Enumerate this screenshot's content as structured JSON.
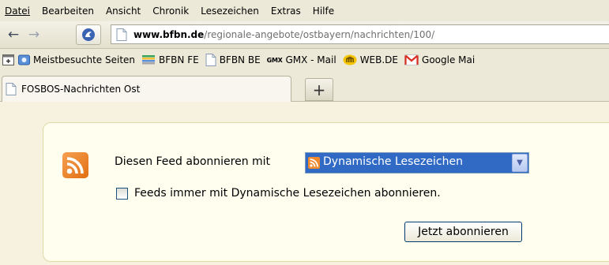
{
  "menubar": {
    "items": [
      {
        "label": "Datei"
      },
      {
        "label": "Bearbeiten"
      },
      {
        "label": "Ansicht"
      },
      {
        "label": "Chronik"
      },
      {
        "label": "Lesezeichen"
      },
      {
        "label": "Extras"
      },
      {
        "label": "Hilfe"
      }
    ]
  },
  "navbar": {
    "url_domain": "www.bfbn.de",
    "url_path": "/regionale-angebote/ostbayern/nachrichten/100/"
  },
  "bookmarks": {
    "items": [
      {
        "label": "Meistbesuchte Seiten"
      },
      {
        "label": "BFBN FE"
      },
      {
        "label": "BFBN BE"
      },
      {
        "label": "GMX - Mail",
        "mark": "GMX"
      },
      {
        "label": "WEB.DE"
      },
      {
        "label": "Google Mai"
      }
    ]
  },
  "tabs": {
    "active_title": "FOSBOS-Nachrichten Ost",
    "new_tab_symbol": "+"
  },
  "feed": {
    "subscribe_label": "Diesen Feed abonnieren mit",
    "reader_selected": "Dynamische Lesezeichen",
    "always_use_label": "Feeds immer mit Dynamische Lesezeichen abonnieren.",
    "always_use_checked": false,
    "subscribe_button": "Jetzt abonnieren"
  },
  "colors": {
    "rss_orange": "#e8801f",
    "selection_blue": "#316ac5",
    "gmail_red": "#d93025"
  }
}
